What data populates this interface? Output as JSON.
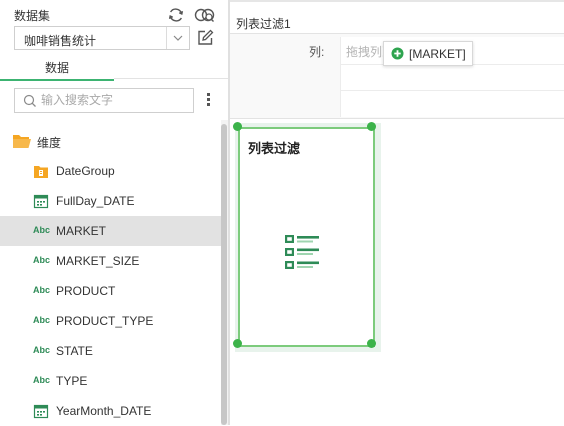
{
  "dataset": {
    "label": "数据集",
    "selected": "咖啡销售统计",
    "refresh_icon": "refresh-icon",
    "view_icon": "dataset-view-icon",
    "edit_icon": "edit-icon"
  },
  "tabs": {
    "data": "数据"
  },
  "search": {
    "placeholder": "输入搜索文字",
    "value": ""
  },
  "tree": {
    "group_label": "维度",
    "fields": [
      {
        "label": "DateGroup",
        "icon": "date-group-icon",
        "selected": false
      },
      {
        "label": "FullDay_DATE",
        "icon": "calendar-icon",
        "selected": false
      },
      {
        "label": "MARKET",
        "icon": "abc-text-icon",
        "selected": true
      },
      {
        "label": "MARKET_SIZE",
        "icon": "abc-text-icon",
        "selected": false
      },
      {
        "label": "PRODUCT",
        "icon": "abc-text-icon",
        "selected": false
      },
      {
        "label": "PRODUCT_TYPE",
        "icon": "abc-text-icon",
        "selected": false
      },
      {
        "label": "STATE",
        "icon": "abc-text-icon",
        "selected": false
      },
      {
        "label": "TYPE",
        "icon": "abc-text-icon",
        "selected": false
      },
      {
        "label": "YearMonth_DATE",
        "icon": "calendar-icon",
        "selected": false
      }
    ],
    "abc_text": "Abc"
  },
  "editor": {
    "header_title": "列表过滤1",
    "column_label": "列:",
    "drop_placeholder": "拖拽列到此处",
    "drag_chip_label": "[MARKET]"
  },
  "widget": {
    "title": "列表过滤"
  },
  "colors": {
    "accent_green": "#3cb34a",
    "folder_orange": "#f5a623",
    "selected_row": "#e2e2e2"
  }
}
